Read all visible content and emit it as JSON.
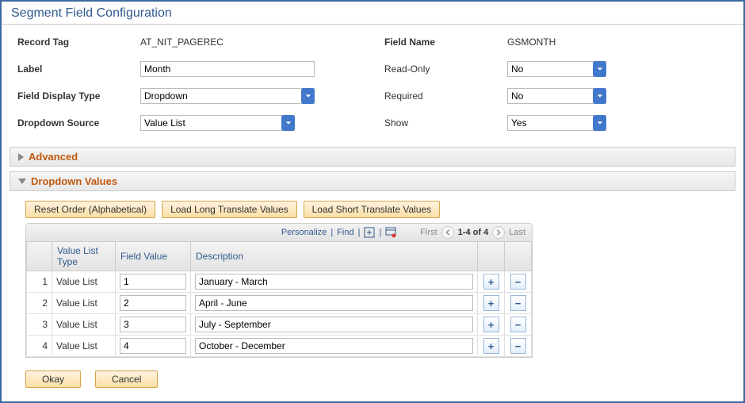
{
  "page": {
    "title": "Segment Field Configuration"
  },
  "form": {
    "left": {
      "recordTag_label": "Record Tag",
      "recordTag_value": "AT_NIT_PAGEREC",
      "label_label": "Label",
      "label_value": "Month",
      "fieldDisplayType_label": "Field Display Type",
      "fieldDisplayType_value": "Dropdown",
      "dropdownSource_label": "Dropdown Source",
      "dropdownSource_value": "Value List"
    },
    "right": {
      "fieldName_label": "Field Name",
      "fieldName_value": "GSMONTH",
      "readOnly_label": "Read-Only",
      "readOnly_value": "No",
      "required_label": "Required",
      "required_value": "No",
      "show_label": "Show",
      "show_value": "Yes"
    }
  },
  "sections": {
    "advanced": "Advanced",
    "dropdownValues": "Dropdown Values"
  },
  "toolbar": {
    "resetOrder": "Reset Order (Alphabetical)",
    "loadLong": "Load Long Translate Values",
    "loadShort": "Load Short Translate Values"
  },
  "grid": {
    "personalize": "Personalize",
    "find": "Find",
    "first": "First",
    "range": "1-4 of 4",
    "last": "Last",
    "headers": {
      "valueListType": "Value List Type",
      "fieldValue": "Field Value",
      "description": "Description"
    },
    "rows": [
      {
        "num": "1",
        "type": "Value List",
        "fieldValue": "1",
        "desc": "January - March"
      },
      {
        "num": "2",
        "type": "Value List",
        "fieldValue": "2",
        "desc": "April - June"
      },
      {
        "num": "3",
        "type": "Value List",
        "fieldValue": "3",
        "desc": "July - September"
      },
      {
        "num": "4",
        "type": "Value List",
        "fieldValue": "4",
        "desc": "October - December"
      }
    ]
  },
  "footer": {
    "okay": "Okay",
    "cancel": "Cancel"
  }
}
